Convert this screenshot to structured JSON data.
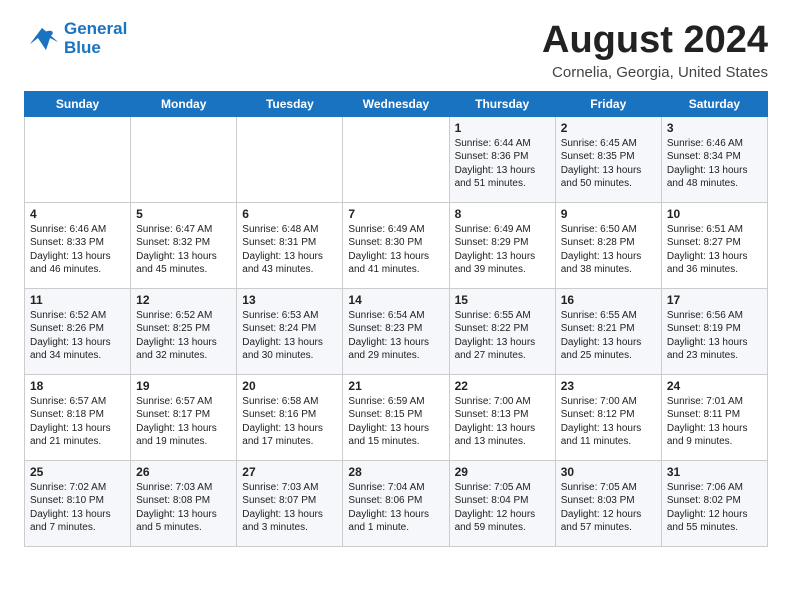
{
  "header": {
    "logo_line1": "General",
    "logo_line2": "Blue",
    "month_year": "August 2024",
    "location": "Cornelia, Georgia, United States"
  },
  "weekdays": [
    "Sunday",
    "Monday",
    "Tuesday",
    "Wednesday",
    "Thursday",
    "Friday",
    "Saturday"
  ],
  "weeks": [
    [
      {
        "day": "",
        "content": ""
      },
      {
        "day": "",
        "content": ""
      },
      {
        "day": "",
        "content": ""
      },
      {
        "day": "",
        "content": ""
      },
      {
        "day": "1",
        "content": "Sunrise: 6:44 AM\nSunset: 8:36 PM\nDaylight: 13 hours\nand 51 minutes."
      },
      {
        "day": "2",
        "content": "Sunrise: 6:45 AM\nSunset: 8:35 PM\nDaylight: 13 hours\nand 50 minutes."
      },
      {
        "day": "3",
        "content": "Sunrise: 6:46 AM\nSunset: 8:34 PM\nDaylight: 13 hours\nand 48 minutes."
      }
    ],
    [
      {
        "day": "4",
        "content": "Sunrise: 6:46 AM\nSunset: 8:33 PM\nDaylight: 13 hours\nand 46 minutes."
      },
      {
        "day": "5",
        "content": "Sunrise: 6:47 AM\nSunset: 8:32 PM\nDaylight: 13 hours\nand 45 minutes."
      },
      {
        "day": "6",
        "content": "Sunrise: 6:48 AM\nSunset: 8:31 PM\nDaylight: 13 hours\nand 43 minutes."
      },
      {
        "day": "7",
        "content": "Sunrise: 6:49 AM\nSunset: 8:30 PM\nDaylight: 13 hours\nand 41 minutes."
      },
      {
        "day": "8",
        "content": "Sunrise: 6:49 AM\nSunset: 8:29 PM\nDaylight: 13 hours\nand 39 minutes."
      },
      {
        "day": "9",
        "content": "Sunrise: 6:50 AM\nSunset: 8:28 PM\nDaylight: 13 hours\nand 38 minutes."
      },
      {
        "day": "10",
        "content": "Sunrise: 6:51 AM\nSunset: 8:27 PM\nDaylight: 13 hours\nand 36 minutes."
      }
    ],
    [
      {
        "day": "11",
        "content": "Sunrise: 6:52 AM\nSunset: 8:26 PM\nDaylight: 13 hours\nand 34 minutes."
      },
      {
        "day": "12",
        "content": "Sunrise: 6:52 AM\nSunset: 8:25 PM\nDaylight: 13 hours\nand 32 minutes."
      },
      {
        "day": "13",
        "content": "Sunrise: 6:53 AM\nSunset: 8:24 PM\nDaylight: 13 hours\nand 30 minutes."
      },
      {
        "day": "14",
        "content": "Sunrise: 6:54 AM\nSunset: 8:23 PM\nDaylight: 13 hours\nand 29 minutes."
      },
      {
        "day": "15",
        "content": "Sunrise: 6:55 AM\nSunset: 8:22 PM\nDaylight: 13 hours\nand 27 minutes."
      },
      {
        "day": "16",
        "content": "Sunrise: 6:55 AM\nSunset: 8:21 PM\nDaylight: 13 hours\nand 25 minutes."
      },
      {
        "day": "17",
        "content": "Sunrise: 6:56 AM\nSunset: 8:19 PM\nDaylight: 13 hours\nand 23 minutes."
      }
    ],
    [
      {
        "day": "18",
        "content": "Sunrise: 6:57 AM\nSunset: 8:18 PM\nDaylight: 13 hours\nand 21 minutes."
      },
      {
        "day": "19",
        "content": "Sunrise: 6:57 AM\nSunset: 8:17 PM\nDaylight: 13 hours\nand 19 minutes."
      },
      {
        "day": "20",
        "content": "Sunrise: 6:58 AM\nSunset: 8:16 PM\nDaylight: 13 hours\nand 17 minutes."
      },
      {
        "day": "21",
        "content": "Sunrise: 6:59 AM\nSunset: 8:15 PM\nDaylight: 13 hours\nand 15 minutes."
      },
      {
        "day": "22",
        "content": "Sunrise: 7:00 AM\nSunset: 8:13 PM\nDaylight: 13 hours\nand 13 minutes."
      },
      {
        "day": "23",
        "content": "Sunrise: 7:00 AM\nSunset: 8:12 PM\nDaylight: 13 hours\nand 11 minutes."
      },
      {
        "day": "24",
        "content": "Sunrise: 7:01 AM\nSunset: 8:11 PM\nDaylight: 13 hours\nand 9 minutes."
      }
    ],
    [
      {
        "day": "25",
        "content": "Sunrise: 7:02 AM\nSunset: 8:10 PM\nDaylight: 13 hours\nand 7 minutes."
      },
      {
        "day": "26",
        "content": "Sunrise: 7:03 AM\nSunset: 8:08 PM\nDaylight: 13 hours\nand 5 minutes."
      },
      {
        "day": "27",
        "content": "Sunrise: 7:03 AM\nSunset: 8:07 PM\nDaylight: 13 hours\nand 3 minutes."
      },
      {
        "day": "28",
        "content": "Sunrise: 7:04 AM\nSunset: 8:06 PM\nDaylight: 13 hours\nand 1 minute."
      },
      {
        "day": "29",
        "content": "Sunrise: 7:05 AM\nSunset: 8:04 PM\nDaylight: 12 hours\nand 59 minutes."
      },
      {
        "day": "30",
        "content": "Sunrise: 7:05 AM\nSunset: 8:03 PM\nDaylight: 12 hours\nand 57 minutes."
      },
      {
        "day": "31",
        "content": "Sunrise: 7:06 AM\nSunset: 8:02 PM\nDaylight: 12 hours\nand 55 minutes."
      }
    ]
  ]
}
